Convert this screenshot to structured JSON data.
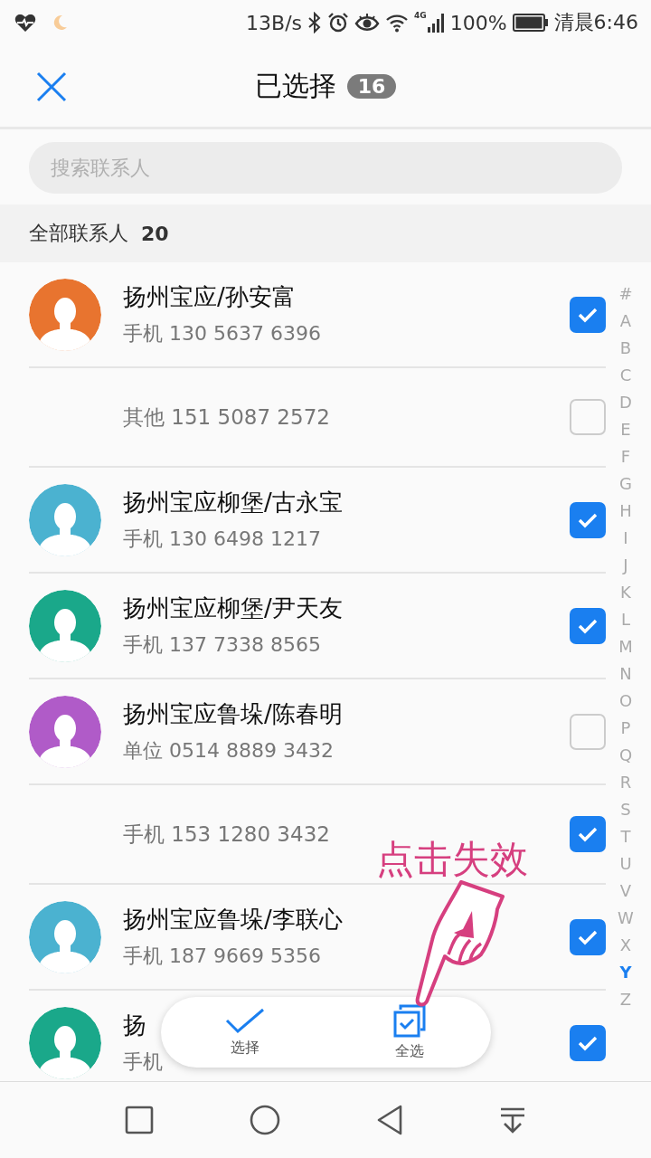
{
  "status_bar": {
    "speed": "13B/s",
    "network": "4G",
    "battery": "100%",
    "time": "清晨6:46"
  },
  "header": {
    "title": "已选择",
    "count": "16"
  },
  "search": {
    "placeholder": "搜索联系人"
  },
  "section": {
    "label": "全部联系人",
    "count": "20"
  },
  "rows": [
    {
      "kind": "contact",
      "name": "扬州宝应/孙安富",
      "phone": "手机 130 5637 6396",
      "color": "#e8742f",
      "checked": true
    },
    {
      "kind": "extra",
      "phone": "其他 151 5087 2572",
      "checked": false
    },
    {
      "kind": "contact",
      "name": "扬州宝应柳堡/古永宝",
      "phone": "手机 130 6498 1217",
      "color": "#4bb2d0",
      "checked": true
    },
    {
      "kind": "contact",
      "name": "扬州宝应柳堡/尹天友",
      "phone": "手机 137 7338 8565",
      "color": "#1aa88a",
      "checked": true
    },
    {
      "kind": "contact",
      "name": "扬州宝应鲁垛/陈春明",
      "phone": "单位 0514 8889 3432",
      "color": "#b05bc8",
      "checked": false
    },
    {
      "kind": "extra",
      "phone": "手机 153 1280 3432",
      "checked": true
    },
    {
      "kind": "contact",
      "name": "扬州宝应鲁垛/李联心",
      "phone": "手机 187 9669 5356",
      "color": "#4bb2d0",
      "checked": true
    },
    {
      "kind": "contact",
      "name": "扬",
      "phone": "手机",
      "color": "#1aa88a",
      "checked": true
    }
  ],
  "index": [
    {
      "letter": "#",
      "selected": false
    },
    {
      "letter": "A",
      "selected": false
    },
    {
      "letter": "B",
      "selected": false
    },
    {
      "letter": "C",
      "selected": false
    },
    {
      "letter": "D",
      "selected": false
    },
    {
      "letter": "E",
      "selected": false
    },
    {
      "letter": "F",
      "selected": false
    },
    {
      "letter": "G",
      "selected": false
    },
    {
      "letter": "H",
      "selected": false
    },
    {
      "letter": "I",
      "selected": false
    },
    {
      "letter": "J",
      "selected": false
    },
    {
      "letter": "K",
      "selected": false
    },
    {
      "letter": "L",
      "selected": false
    },
    {
      "letter": "M",
      "selected": false
    },
    {
      "letter": "N",
      "selected": false
    },
    {
      "letter": "O",
      "selected": false
    },
    {
      "letter": "P",
      "selected": false
    },
    {
      "letter": "Q",
      "selected": false
    },
    {
      "letter": "R",
      "selected": false
    },
    {
      "letter": "S",
      "selected": false
    },
    {
      "letter": "T",
      "selected": false
    },
    {
      "letter": "U",
      "selected": false
    },
    {
      "letter": "V",
      "selected": false
    },
    {
      "letter": "W",
      "selected": false
    },
    {
      "letter": "X",
      "selected": false
    },
    {
      "letter": "Y",
      "selected": true
    },
    {
      "letter": "Z",
      "selected": false
    }
  ],
  "action_bar": [
    {
      "kind": "select",
      "label": "选择"
    },
    {
      "kind": "select_all",
      "label": "全选"
    }
  ],
  "annotation": {
    "text": "点击失效"
  }
}
